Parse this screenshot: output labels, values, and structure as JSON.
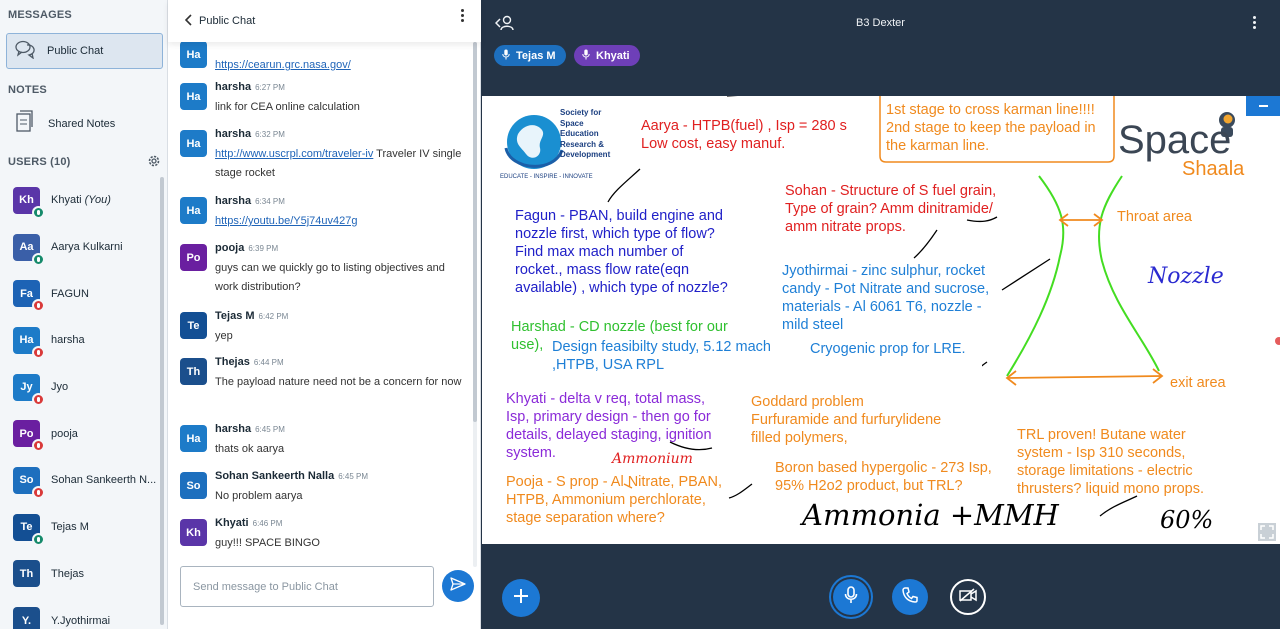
{
  "sidebar": {
    "messages_title": "MESSAGES",
    "public_chat_label": "Public Chat",
    "notes_title": "NOTES",
    "shared_notes_label": "Shared Notes",
    "users_title": "USERS (10)",
    "users": [
      {
        "initials": "Kh",
        "name": "Khyati",
        "suffix": "(You)",
        "color": "#5a35a8",
        "status": "unmuted"
      },
      {
        "initials": "Aa",
        "name": "Aarya Kulkarni",
        "suffix": "",
        "color": "#3a5fa8",
        "status": "unmuted"
      },
      {
        "initials": "Fa",
        "name": "FAGUN",
        "suffix": "",
        "color": "#1d63b5",
        "status": "muted"
      },
      {
        "initials": "Ha",
        "name": "harsha",
        "suffix": "",
        "color": "#1d7bc8",
        "status": "muted"
      },
      {
        "initials": "Jy",
        "name": "Jyo",
        "suffix": "",
        "color": "#1d7bc8",
        "status": "muted"
      },
      {
        "initials": "Po",
        "name": "pooja",
        "suffix": "",
        "color": "#6a1fa0",
        "status": "muted"
      },
      {
        "initials": "So",
        "name": "Sohan Sankeerth N...",
        "suffix": "",
        "color": "#1d6fbe",
        "status": "muted"
      },
      {
        "initials": "Te",
        "name": "Tejas M",
        "suffix": "",
        "color": "#134f94",
        "status": "unmuted"
      },
      {
        "initials": "Th",
        "name": "Thejas",
        "suffix": "",
        "color": "#1b4f8c",
        "status": "none"
      },
      {
        "initials": "Y.",
        "name": "Y.Jyothirmai",
        "suffix": "",
        "color": "#1b4f8c",
        "status": "none"
      }
    ]
  },
  "chat": {
    "title": "Public Chat",
    "input_placeholder": "Send message to Public Chat",
    "messages": [
      {
        "initials": "Ha",
        "color": "#1d7bc8",
        "name": "",
        "time": "",
        "text": "",
        "link": "https://cearun.grc.nasa.gov/",
        "after": ""
      },
      {
        "initials": "Ha",
        "color": "#1d7bc8",
        "name": "harsha",
        "time": "6:27 PM",
        "text": "link for CEA online calculation",
        "link": "",
        "after": ""
      },
      {
        "initials": "Ha",
        "color": "#1d7bc8",
        "name": "harsha",
        "time": "6:32 PM",
        "text": "",
        "link": "http://www.uscrpl.com/traveler-iv",
        "after": " Traveler IV single stage rocket"
      },
      {
        "initials": "Ha",
        "color": "#1d7bc8",
        "name": "harsha",
        "time": "6:34 PM",
        "text": "",
        "link": "https://youtu.be/Y5j74uv427g",
        "after": ""
      },
      {
        "initials": "Po",
        "color": "#6a1fa0",
        "name": "pooja",
        "time": "6:39 PM",
        "text": "guys can we quickly go to listing objectives and work distribution?",
        "link": "",
        "after": ""
      },
      {
        "initials": "Te",
        "color": "#134f94",
        "name": "Tejas M",
        "time": "6:42 PM",
        "text": "yep",
        "link": "",
        "after": ""
      },
      {
        "initials": "Th",
        "color": "#1b4f8c",
        "name": "Thejas",
        "time": "6:44 PM",
        "text": "The payload nature need not be a concern for now",
        "link": "",
        "after": ""
      },
      {
        "initials": "Ha",
        "color": "#1d7bc8",
        "name": "harsha",
        "time": "6:45 PM",
        "text": "thats ok aarya",
        "link": "",
        "after": ""
      },
      {
        "initials": "So",
        "color": "#1d6fbe",
        "name": "Sohan Sankeerth Nalla",
        "time": "6:45 PM",
        "text": "No problem aarya",
        "link": "",
        "after": ""
      },
      {
        "initials": "Kh",
        "color": "#5a35a8",
        "name": "Khyati",
        "time": "6:46 PM",
        "text": "guy!!! SPACE BINGO",
        "link": "",
        "after": ""
      }
    ]
  },
  "main": {
    "room_title": "B3 Dexter",
    "talkers": [
      {
        "name": "Tejas M",
        "color": "#1d6fbe"
      },
      {
        "name": "Khyati",
        "color": "#6e3fb8"
      }
    ]
  },
  "whiteboard": {
    "logo_org": [
      "Society for",
      "Space",
      "Education",
      "Research &",
      "Development"
    ],
    "logo_tagline": "EDUCATE - INSPIRE - INNOVATE",
    "logo_brand_1": "Space",
    "logo_brand_2": "Shaala",
    "notes": [
      {
        "text": "Aarya - HTPB(fuel) , Isp = 280 s\nLow cost, easy manuf.",
        "color": "#e02020"
      },
      {
        "text": "1st stage to cross karman line!!!!\n2nd stage to keep the payload in\nthe karman line.",
        "color": "#f08a1e"
      },
      {
        "text": "Sohan - Structure of S fuel grain,\nType of grain? Amm dinitramide/\namm nitrate props.",
        "color": "#e02020"
      },
      {
        "text": "Throat area",
        "color": "#f08a1e"
      },
      {
        "text": "Fagun - PBAN, build engine and\nnozzle first, which type of flow?\nFind max mach number of\nrocket., mass flow rate(eqn\navailable) , which type of nozzle?",
        "color": "#2020c8"
      },
      {
        "text": "Jyothirmai - zinc sulphur, rocket\ncandy - Pot Nitrate and sucrose,\nmaterials - Al 6061 T6, nozzle -\nmild steel",
        "color": "#1e7fd6"
      },
      {
        "text": "Harshad - CD nozzle (best for our\nuse),",
        "color": "#30c030"
      },
      {
        "text": "Design feasibilty study, 5.12 mach\n,HTPB, USA RPL",
        "color": "#1e7fd6"
      },
      {
        "text": "Cryogenic prop for LRE.",
        "color": "#1e7fd6"
      },
      {
        "text": "exit area",
        "color": "#f08a1e"
      },
      {
        "text": "Khyati - delta v req, total mass,\nIsp, primary design - then go for\ndetails, delayed staging, ignition\nsystem.",
        "color": "#8a2ad8"
      },
      {
        "text": "Goddard problem\nFurfuramide and furfurylidene\nfilled polymers,",
        "color": "#f08a1e"
      },
      {
        "text": "TRL proven! Butane water\nsystem - Isp 310 seconds,\nstorage limitations - electric\nthrusters? liquid mono props.",
        "color": "#f08a1e"
      },
      {
        "text": "Pooja - S prop - Al Nitrate, PBAN,\nHTPB, Ammonium perchlorate,\nstage separation where?",
        "color": "#f08a1e"
      },
      {
        "text": "Boron based hypergolic - 273 Isp,\n95% H2o2 product, but TRL?",
        "color": "#f08a1e"
      }
    ],
    "handwriting": [
      {
        "text": "Nozzle",
        "color": "#2a2ad0"
      },
      {
        "text": "Ammonia +MMH",
        "color": "#000000"
      },
      {
        "text": "60%",
        "color": "#000000"
      },
      {
        "text": "Ammonium",
        "color": "#e02020"
      }
    ]
  }
}
